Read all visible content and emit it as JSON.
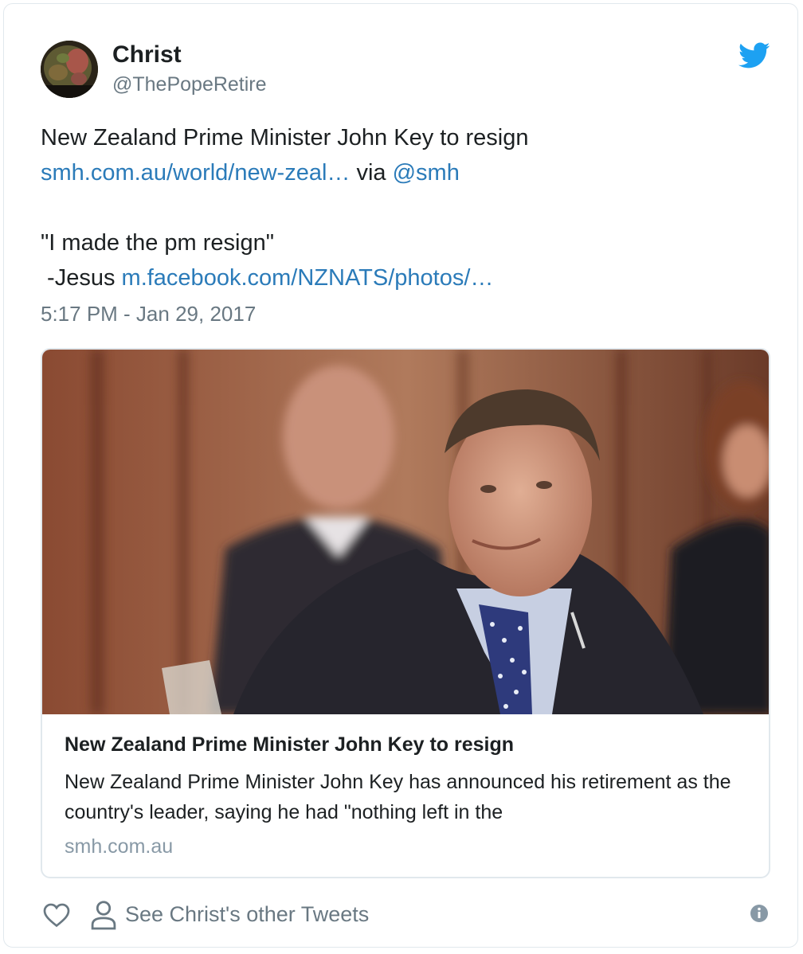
{
  "author": {
    "name": "Christ",
    "handle": "@ThePopeRetire"
  },
  "tweet": {
    "line1": "New Zealand Prime Minister John Key to resign",
    "link1": "smh.com.au/world/new-zeal…",
    "via_text": " via ",
    "mention": "@smh",
    "quote": "\"I made the pm resign\"",
    "attribution": " -Jesus ",
    "link2": "m.facebook.com/NZNATS/photos/…",
    "timestamp": "5:17 PM - Jan 29, 2017"
  },
  "embed": {
    "title": "New Zealand Prime Minister John Key to resign",
    "description": "New Zealand Prime Minister John Key has announced his retirement as the country's leader, saying he had \"nothing left in the",
    "domain": "smh.com.au"
  },
  "footer": {
    "other_tweets_label": "See Christ's other Tweets"
  },
  "icons": {
    "brand": "twitter-bird-icon",
    "like": "heart-icon",
    "profile": "person-icon",
    "info": "info-icon"
  },
  "colors": {
    "link": "#2b7bb9",
    "twitter_blue": "#1da1f2",
    "muted": "#697882",
    "border": "#e1e8ed"
  }
}
